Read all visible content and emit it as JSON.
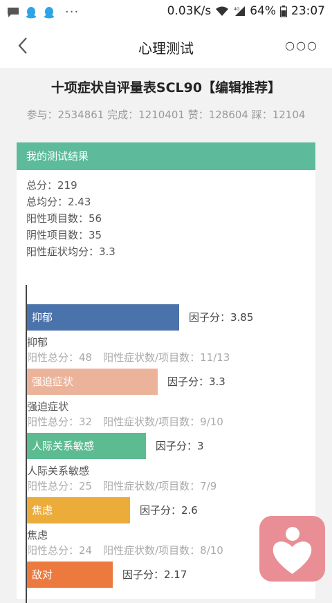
{
  "status_bar": {
    "speed": "0.03K/s",
    "battery": "64%",
    "time": "23:07",
    "icons": [
      "message-icon",
      "qq-icon",
      "qq-icon",
      "more-notifications-icon",
      "wifi-icon",
      "signal-4g-icon",
      "battery-icon"
    ]
  },
  "header": {
    "title": "心理测试",
    "back_icon": "chevron-left-icon",
    "more_icon": "more-icon"
  },
  "page": {
    "title": "十项症状自评量表SCL90【编辑推荐】",
    "stats": "参与：2534861 完成：1210401 赞：128604 踩：12104"
  },
  "result": {
    "header": "我的测试结果",
    "summary": [
      "总分：219",
      "总均分：2.43",
      "阳性项目数：56",
      "阴性项目数：35",
      "阳性症状均分：3.3"
    ]
  },
  "factors": [
    {
      "name": "抑郁",
      "score_text": "因子分：3.85",
      "score": 3.85,
      "color": "#4a72ab",
      "pos_total": "阳性总分：48",
      "ratio": "阳性症状数/项目数：11/13"
    },
    {
      "name": "强迫症状",
      "score_text": "因子分：3.3",
      "score": 3.3,
      "color": "#ebb39a",
      "pos_total": "阳性总分：32",
      "ratio": "阳性症状数/项目数：9/10"
    },
    {
      "name": "人际关系敏感",
      "score_text": "因子分：3",
      "score": 3,
      "color": "#5dbb92",
      "pos_total": "阳性总分：25",
      "ratio": "阳性症状数/项目数：7/9"
    },
    {
      "name": "焦虑",
      "score_text": "因子分：2.6",
      "score": 2.6,
      "color": "#ecac3a",
      "pos_total": "阳性总分：24",
      "ratio": "阳性症状数/项目数：8/10"
    },
    {
      "name": "敌对",
      "score_text": "因子分：2.17",
      "score": 2.17,
      "color": "#ec7a3f",
      "pos_total": "",
      "ratio": ""
    }
  ],
  "floating_button": {
    "icon": "heart-person-icon"
  }
}
